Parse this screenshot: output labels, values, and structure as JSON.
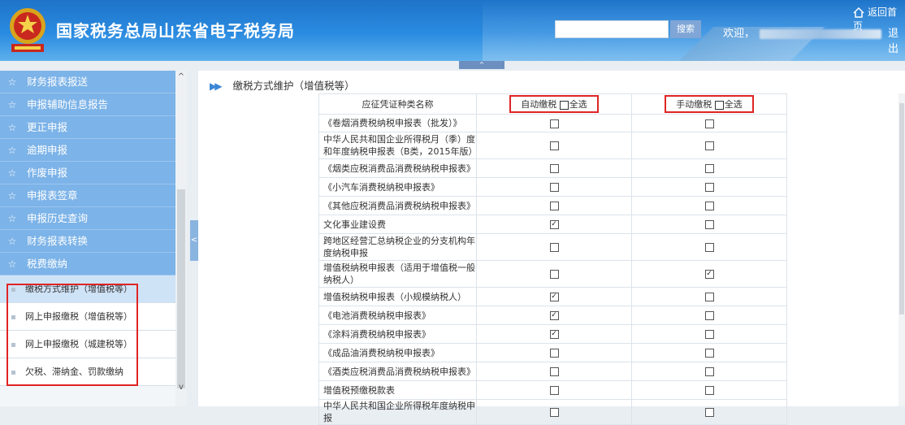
{
  "header": {
    "title": "国家税务总局山东省电子税务局",
    "search_placeholder": "",
    "search_button": "搜索",
    "welcome": "欢迎，",
    "logout": "退出",
    "home": "返回首页"
  },
  "top_collapse": "^",
  "side_toggle": "<",
  "sidebar": {
    "items": [
      {
        "label": "财务报表报送"
      },
      {
        "label": "申报辅助信息报告"
      },
      {
        "label": "更正申报"
      },
      {
        "label": "逾期申报"
      },
      {
        "label": "作废申报"
      },
      {
        "label": "申报表签章"
      },
      {
        "label": "申报历史查询"
      },
      {
        "label": "财务报表转换"
      },
      {
        "label": "税费缴纳"
      }
    ],
    "sub_items": [
      {
        "label": "缴税方式维护（增值税等）"
      },
      {
        "label": "网上申报缴税（增值税等）"
      },
      {
        "label": "网上申报缴税（城建税等）"
      },
      {
        "label": "欠税、滞纳金、罚款缴纳"
      }
    ],
    "scroll_up": "^",
    "scroll_down": "v"
  },
  "main": {
    "breadcrumb": "缴税方式维护（增值税等）",
    "columns": {
      "name": "应征凭证种类名称",
      "auto": "自动缴税",
      "manual": "手动缴税",
      "select_all": "全选"
    },
    "rows": [
      {
        "name": "《卷烟消费税纳税申报表（批发）》",
        "auto": false,
        "manual": false
      },
      {
        "name": "中华人民共和国企业所得税月（季）度和年度纳税申报表（B类，2015年版）",
        "auto": false,
        "manual": false
      },
      {
        "name": "《烟类应税消费品消费税纳税申报表》",
        "auto": false,
        "manual": false
      },
      {
        "name": "《小汽车消费税纳税申报表》",
        "auto": false,
        "manual": false
      },
      {
        "name": "《其他应税消费品消费税纳税申报表》",
        "auto": false,
        "manual": false
      },
      {
        "name": "文化事业建设费",
        "auto": true,
        "manual": false
      },
      {
        "name": "跨地区经营汇总纳税企业的分支机构年度纳税申报",
        "auto": false,
        "manual": false
      },
      {
        "name": "增值税纳税申报表（适用于增值税一般纳税人）",
        "auto": false,
        "manual": true
      },
      {
        "name": "增值税纳税申报表（小规模纳税人）",
        "auto": true,
        "manual": false
      },
      {
        "name": "《电池消费税纳税申报表》",
        "auto": true,
        "manual": false
      },
      {
        "name": "《涂料消费税纳税申报表》",
        "auto": true,
        "manual": false
      },
      {
        "name": "《成品油消费税纳税申报表》",
        "auto": false,
        "manual": false
      },
      {
        "name": "《酒类应税消费品消费税纳税申报表》",
        "auto": false,
        "manual": false
      },
      {
        "name": "增值税预缴税款表",
        "auto": false,
        "manual": false
      },
      {
        "name": "中华人民共和国企业所得税年度纳税申报",
        "auto": false,
        "manual": false
      }
    ],
    "check_mark": "✓"
  },
  "colors": {
    "accent": "#7cb3e8",
    "highlight": "#e02424",
    "header": "#2a8be0"
  }
}
